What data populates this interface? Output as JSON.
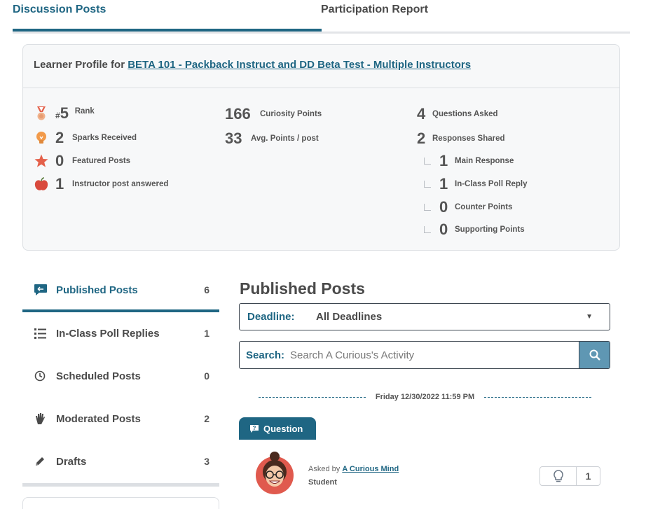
{
  "tabs": [
    {
      "label": "Discussion Posts",
      "active": true
    },
    {
      "label": "Participation Report",
      "active": false
    }
  ],
  "profile": {
    "prefix": "Learner Profile for",
    "course": "BETA 101 - Packback Instruct and DD Beta Test - Multiple Instructors",
    "col1": [
      {
        "icon": "medal-icon",
        "num": "5",
        "hash": "#",
        "label": "Rank"
      },
      {
        "icon": "lightbulb-icon",
        "num": "2",
        "label": "Sparks Received"
      },
      {
        "icon": "star-icon",
        "num": "0",
        "label": "Featured Posts"
      },
      {
        "icon": "apple-icon",
        "num": "1",
        "label": "Instructor post answered"
      }
    ],
    "col2": [
      {
        "num": "166",
        "label": "Curiosity Points"
      },
      {
        "num": "33",
        "label": "Avg. Points / post"
      }
    ],
    "col3": [
      {
        "num": "4",
        "label": "Questions Asked"
      },
      {
        "num": "2",
        "label": "Responses Shared"
      }
    ],
    "sub": [
      {
        "num": "1",
        "label": "Main Response"
      },
      {
        "num": "1",
        "label": "In-Class Poll Reply"
      },
      {
        "num": "0",
        "label": "Counter Points"
      },
      {
        "num": "0",
        "label": "Supporting Points"
      }
    ]
  },
  "sidebar": [
    {
      "icon": "chat-bubble-icon",
      "label": "Published Posts",
      "count": "6",
      "active": true
    },
    {
      "icon": "list-icon",
      "label": "In-Class Poll Replies",
      "count": "1"
    },
    {
      "icon": "clock-icon",
      "label": "Scheduled Posts",
      "count": "0"
    },
    {
      "icon": "hand-icon",
      "label": "Moderated Posts",
      "count": "2"
    },
    {
      "icon": "pencil-icon",
      "label": "Drafts",
      "count": "3"
    }
  ],
  "main": {
    "title": "Published Posts",
    "deadline_label": "Deadline:",
    "deadline_value": "All Deadlines",
    "search_label": "Search:",
    "search_placeholder": "Search A Curious's Activity",
    "date": "Friday 12/30/2022 11:59 PM",
    "badge": "Question",
    "asked_by": "Asked by",
    "author": "A Curious Mind",
    "role": "Student",
    "sparks": "1"
  },
  "colors": {
    "accent": "#1f6683",
    "search_button": "#5f97b3"
  }
}
